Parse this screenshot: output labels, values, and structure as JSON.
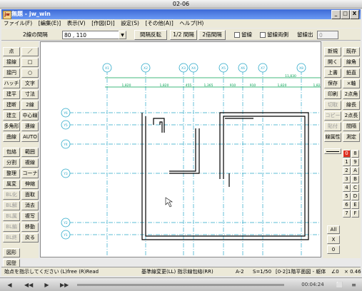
{
  "screen_title": "02-06",
  "window": {
    "title": "無題 - jw_win",
    "app_icon_label": "jw",
    "min_label": "_",
    "max_label": "□",
    "close_label": "X"
  },
  "menu": [
    "ファイル(F)",
    "[編集(E)]",
    "表示(V)",
    "[作図(D)]",
    "設定(S)",
    "[その他(A)]",
    "ヘルプ(H)"
  ],
  "toolbar": {
    "spacing_label": "2線の間隔",
    "spacing_value": "80 , 110",
    "btn_reverse": "間隔反転",
    "btn_half": "1/2 間隔",
    "btn_double": "2倍間隔",
    "chk_center_label": "留線",
    "chk_both_label": "留線両側",
    "out_label": "留線出",
    "out_value": "0"
  },
  "left_tools": [
    [
      "点",
      "／"
    ],
    [
      "接線",
      "□"
    ],
    [
      "接円",
      "○"
    ],
    [
      "ハッチ",
      "文字"
    ],
    [
      "建平",
      "寸法"
    ],
    [
      "建断",
      "2線"
    ],
    [
      "建立",
      "中心線"
    ],
    [
      "多角形",
      "連線"
    ],
    [
      "曲線",
      "AUTO"
    ],
    [
      "包絡",
      "範囲"
    ],
    [
      "分割",
      "複線"
    ],
    [
      "整理",
      "コーナー"
    ],
    [
      "属変",
      "伸縮"
    ],
    [
      "BL化",
      "面取"
    ],
    [
      "BL解",
      "消去"
    ],
    [
      "BL属",
      "複写"
    ],
    [
      "BL編",
      "移動"
    ],
    [
      "BL終",
      "戻る"
    ],
    [
      "図形",
      ""
    ],
    [
      "図登",
      ""
    ]
  ],
  "right_tools": [
    [
      "新規",
      "既存"
    ],
    [
      "開く",
      "線角"
    ],
    [
      "上書",
      "鉛直"
    ],
    [
      "保存",
      "×軸"
    ],
    [
      "印刷",
      "2点角"
    ],
    [
      "切取",
      "線長"
    ],
    [
      "コピー",
      "2点長"
    ],
    [
      "貼付",
      "間隔"
    ],
    [
      "線属性",
      "測定"
    ]
  ],
  "layer_buttons": [
    [
      "0",
      "8"
    ],
    [
      "1",
      "9"
    ],
    [
      "2",
      "A"
    ],
    [
      "3",
      "B"
    ],
    [
      "4",
      "C"
    ],
    [
      "5",
      "D"
    ],
    [
      "6",
      "E"
    ],
    [
      "7",
      "F"
    ]
  ],
  "layer_extra": [
    "All",
    "X",
    "0"
  ],
  "drawing": {
    "grid_labels_top": [
      "X1",
      "X2",
      "X3",
      "X4",
      "X5",
      "X6",
      "X7",
      "X8"
    ],
    "grid_labels_left": [
      "Y6",
      "Y5",
      "Y4",
      "Y3",
      "Y2",
      "Y1"
    ],
    "dims": [
      "1,820",
      "1,820",
      "455",
      "1,365",
      "910",
      "910",
      "1,820",
      "1,820"
    ],
    "overall_dim": "11,830"
  },
  "status": {
    "message": "始点を指示してください (L)free (R)Read",
    "base": "基準線変更(LL) 指示線包絡(RR)",
    "paper": "A-2",
    "scale": "S=1/50",
    "layer": "[0-2]1階平面図 - 躯体",
    "angle": "∠0",
    "zoom": "× 0.46"
  },
  "player": {
    "time": "00:04:24"
  },
  "colors": {
    "grid_line": "#2aa8c8",
    "dim_line": "#00a050",
    "wall_line": "#000000",
    "title_bar": "#3d6ad6",
    "layer_active": "#e03020"
  }
}
